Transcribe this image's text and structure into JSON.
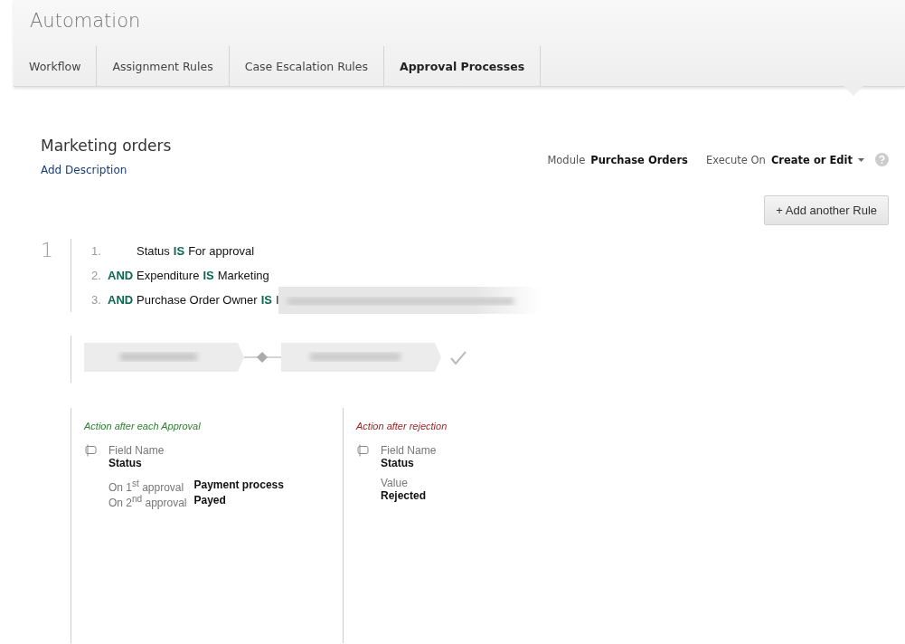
{
  "header": {
    "title": "Automation"
  },
  "tabs": [
    {
      "label": "Workflow",
      "selected": false
    },
    {
      "label": "Assignment Rules",
      "selected": false
    },
    {
      "label": "Case Escalation Rules",
      "selected": false
    },
    {
      "label": "Approval Processes",
      "selected": true
    }
  ],
  "process": {
    "name": "Marketing orders",
    "description_link": "Add Description",
    "module_label": "Module",
    "module_value": "Purchase Orders",
    "execute_label": "Execute On",
    "execute_value": "Create or Edit"
  },
  "add_rule_button": "+ Add another Rule",
  "rules": [
    {
      "number": "1",
      "criteria": [
        {
          "index": "1.",
          "field": "Status",
          "operator": "IS",
          "value": "For approval",
          "redacted": false
        },
        {
          "index": "2.",
          "connector": "AND",
          "field": "Expenditure",
          "operator": "IS",
          "value": "Marketing",
          "redacted": false
        },
        {
          "index": "3.",
          "connector": "AND",
          "field": "Purchase Order Owner",
          "operator": "IS",
          "value": "I",
          "redacted": true
        }
      ],
      "approval_title": "Action after each Approval",
      "approval_field_label": "Field Name",
      "approval_field": "Status",
      "approval_steps": [
        {
          "label": "On 1$^{st}$ approval",
          "value": "Payment process"
        },
        {
          "label": "On 2$^{nd}$ approval",
          "value": "Payed"
        }
      ],
      "rejection_title": "Action after rejection",
      "rejection_field_label": "Field Name",
      "rejection_field": "Status",
      "rejection_value_label": "Value",
      "rejection_value": "Rejected"
    }
  ]
}
